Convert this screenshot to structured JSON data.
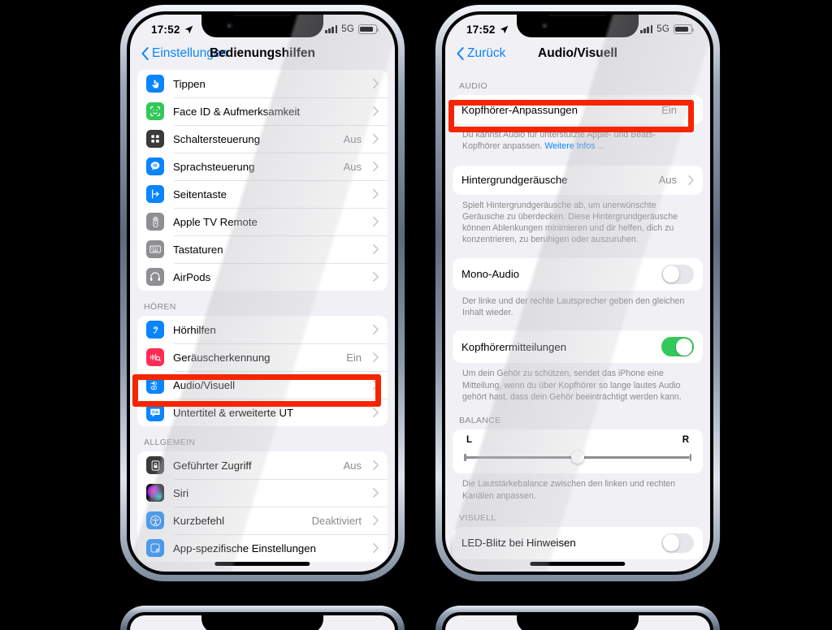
{
  "status_bar": {
    "time": "17:52",
    "network": "5G",
    "location_icon": "location-arrow-icon",
    "signal_icon": "cellular-bars-icon",
    "battery_icon": "battery-icon"
  },
  "left_phone": {
    "nav": {
      "back_label": "Einstellungen",
      "title": "Bedienungshilfen"
    },
    "groups": [
      {
        "header": "",
        "rows": [
          {
            "label": "Tippen",
            "value": "",
            "icon": "hand-tap-icon",
            "icon_color": "#0a84ff",
            "accessory": "chevron-right-icon"
          },
          {
            "label": "Face ID & Aufmerksamkeit",
            "value": "",
            "icon": "face-id-icon",
            "icon_color": "#34c759",
            "accessory": "chevron-right-icon"
          },
          {
            "label": "Schaltersteuerung",
            "value": "Aus",
            "icon": "switch-control-icon",
            "icon_color": "#3a3a3c",
            "accessory": "chevron-right-icon"
          },
          {
            "label": "Sprachsteuerung",
            "value": "Aus",
            "icon": "voice-control-icon",
            "icon_color": "#0a84ff",
            "accessory": "chevron-right-icon"
          },
          {
            "label": "Seitentaste",
            "value": "",
            "icon": "side-button-icon",
            "icon_color": "#0a84ff",
            "accessory": "chevron-right-icon"
          },
          {
            "label": "Apple TV Remote",
            "value": "",
            "icon": "apple-tv-remote-icon",
            "icon_color": "#8e8e93",
            "accessory": "chevron-right-icon"
          },
          {
            "label": "Tastaturen",
            "value": "",
            "icon": "keyboard-icon",
            "icon_color": "#8e8e93",
            "accessory": "chevron-right-icon"
          },
          {
            "label": "AirPods",
            "value": "",
            "icon": "airpods-headphones-icon",
            "icon_color": "#8e8e93",
            "accessory": "chevron-right-icon"
          }
        ]
      },
      {
        "header": "HÖREN",
        "rows": [
          {
            "label": "Hörhilfen",
            "value": "",
            "icon": "hearing-aid-icon",
            "icon_color": "#0a84ff",
            "accessory": "chevron-right-icon"
          },
          {
            "label": "Geräuscherkennung",
            "value": "Ein",
            "icon": "sound-recognition-icon",
            "icon_color": "#ff2d55",
            "accessory": "chevron-right-icon"
          },
          {
            "label": "Audio/Visuell",
            "value": "",
            "icon": "audio-visual-icon",
            "icon_color": "#0a84ff",
            "accessory": "chevron-right-icon",
            "highlighted": true
          },
          {
            "label": "Untertitel & erweiterte UT",
            "value": "",
            "icon": "subtitles-icon",
            "icon_color": "#0a84ff",
            "accessory": "chevron-right-icon"
          }
        ]
      },
      {
        "header": "ALLGEMEIN",
        "rows": [
          {
            "label": "Geführter Zugriff",
            "value": "Aus",
            "icon": "guided-access-lock-icon",
            "icon_color": "#3a3a3c",
            "accessory": "chevron-right-icon"
          },
          {
            "label": "Siri",
            "value": "",
            "icon": "siri-icon",
            "icon_color": "#1c1c1e",
            "accessory": "chevron-right-icon"
          },
          {
            "label": "Kurzbefehl",
            "value": "Deaktiviert",
            "icon": "accessibility-shortcut-icon",
            "icon_color": "#0a84ff",
            "accessory": "chevron-right-icon"
          },
          {
            "label": "App-spezifische Einstellungen",
            "value": "",
            "icon": "per-app-settings-icon",
            "icon_color": "#0a84ff",
            "accessory": "chevron-right-icon"
          }
        ]
      }
    ]
  },
  "right_phone": {
    "nav": {
      "back_label": "Zurück",
      "title": "Audio/Visuell"
    },
    "sections": {
      "audio_header": "AUDIO",
      "headphone_accommodations": {
        "label": "Kopfhörer-Anpassungen",
        "value": "Ein",
        "accessory": "chevron-right-icon",
        "highlighted": true
      },
      "headphone_footnote_part1": "Du kannst Audio für unterstützte Apple- und Beats-Kopfhörer anpassen. ",
      "headphone_footnote_link": "Weitere Infos",
      "headphone_footnote_part2": " ...",
      "background_sounds": {
        "label": "Hintergrundgeräusche",
        "value": "Aus",
        "accessory": "chevron-right-icon"
      },
      "background_sounds_footnote": "Spielt Hintergrundgeräusche ab, um unerwünschte Geräusche zu überdecken. Diese Hintergrundgeräusche können Ablenkungen minimieren und dir helfen, dich zu konzentrieren, zu beruhigen oder auszuruhen.",
      "mono_audio": {
        "label": "Mono-Audio",
        "state": "off"
      },
      "mono_audio_footnote": "Der linke und der rechte Lautsprecher geben den gleichen Inhalt wieder.",
      "headphone_notifications": {
        "label": "Kopfhörermitteilungen",
        "state": "on"
      },
      "headphone_notifications_footnote": "Um dein Gehör zu schützen, sendet das iPhone eine Mitteilung, wenn du über Kopfhörer so lange lautes Audio gehört hast, dass dein Gehör beeinträchtigt werden kann.",
      "balance_header": "BALANCE",
      "balance_left_label": "L",
      "balance_right_label": "R",
      "balance_value": 50,
      "balance_footnote": "Die Lautstärkebalance zwischen den linken und rechten Kanälen anpassen.",
      "visual_header": "VISUELL",
      "led_flash": {
        "label": "LED-Blitz bei Hinweisen",
        "state": "off"
      }
    }
  },
  "colors": {
    "highlight_red": "#f62500",
    "ios_blue": "#0a84ff",
    "toggle_green": "#34c759",
    "background": "#000000",
    "screen_bg": "#f1f1f5"
  }
}
